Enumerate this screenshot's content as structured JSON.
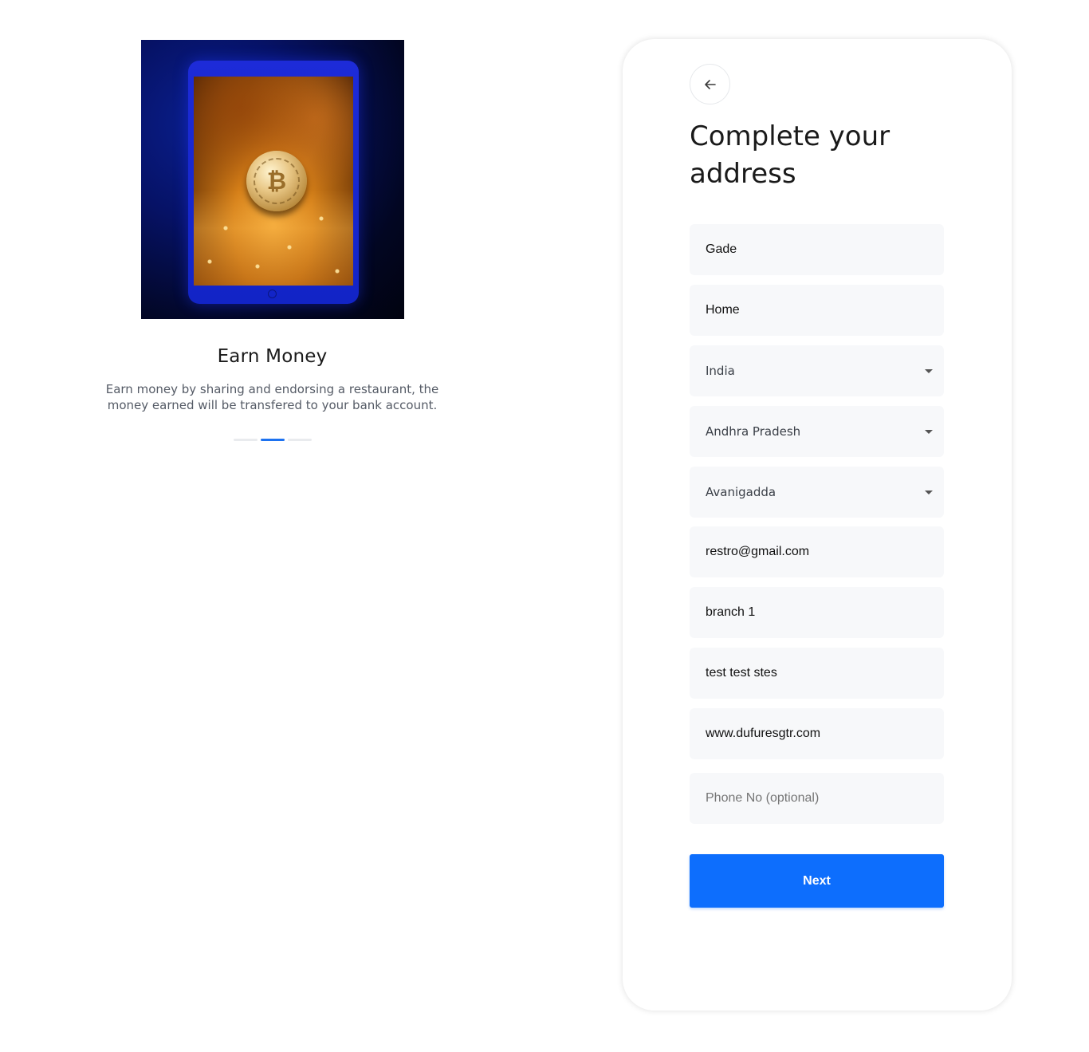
{
  "onboarding": {
    "title": "Earn Money",
    "description": "Earn money by sharing and endorsing a restaurant, the money earned will be transfered to your bank account.",
    "image_alt": "tablet showing a bitcoin coin",
    "slide_count": 3,
    "active_slide": 2
  },
  "form": {
    "title": "Complete your address",
    "back_icon": "arrow-left-icon",
    "fields": {
      "name": "Gade",
      "address_type": "Home",
      "country": "India",
      "state": "Andhra Pradesh",
      "city": "Avanigadda",
      "email": "restro@gmail.com",
      "branch": "branch 1",
      "address": "test test stes",
      "website": "www.dufuresgtr.com",
      "phone_value": "",
      "phone_placeholder": "Phone No (optional)"
    },
    "next_label": "Next"
  },
  "colors": {
    "primary": "#0d6efd",
    "field_bg": "#f7f8fa",
    "active_dot": "#1d72f0"
  }
}
